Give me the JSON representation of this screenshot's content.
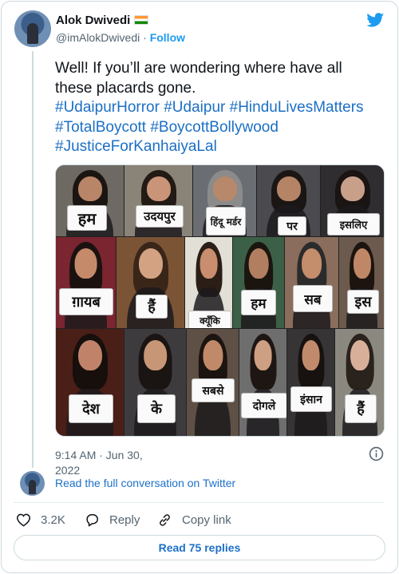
{
  "author": {
    "name": "Alok Dwivedi",
    "handle": "@imAlokDwivedi",
    "separator": "·",
    "follow_label": "Follow"
  },
  "tweet": {
    "lines": [
      "Well! If you’ll are wondering where have all",
      "these placards gone."
    ],
    "hashtag_lines": [
      [
        "#UdaipurHorror",
        "#Udaipur",
        "#HinduLivesMatters"
      ],
      [
        "#TotalBoycott",
        "#BoycottBollywood"
      ],
      [
        "#JusticeForKanhaiyaLal"
      ]
    ]
  },
  "media": {
    "placards": [
      "हम",
      "उदयपुर",
      "हिंदू मर्डर",
      "पर",
      "इसलिए",
      "ग़ायब",
      "हैं",
      "क्यूँकि",
      "हम",
      "सब",
      "इस",
      "देश",
      "के",
      "सबसे",
      "दोगले",
      "इंसान",
      "हैं"
    ]
  },
  "footer": {
    "time": "9:14 AM · Jun 30, 2022",
    "read_conversation": "Read the full conversation on Twitter",
    "like_count": "3.2K",
    "reply_label": "Reply",
    "copy_link_label": "Copy link",
    "read_replies": "Read 75 replies"
  },
  "colors": {
    "accent": "#1d9bf0",
    "link": "#1b6fc5",
    "muted": "#536471",
    "border": "#cfd9de"
  },
  "icons": {
    "brand": "twitter-bird-icon",
    "flag": "india-flag-icon",
    "info": "info-icon",
    "like": "heart-icon",
    "reply": "speech-bubble-icon",
    "copy": "link-icon"
  }
}
